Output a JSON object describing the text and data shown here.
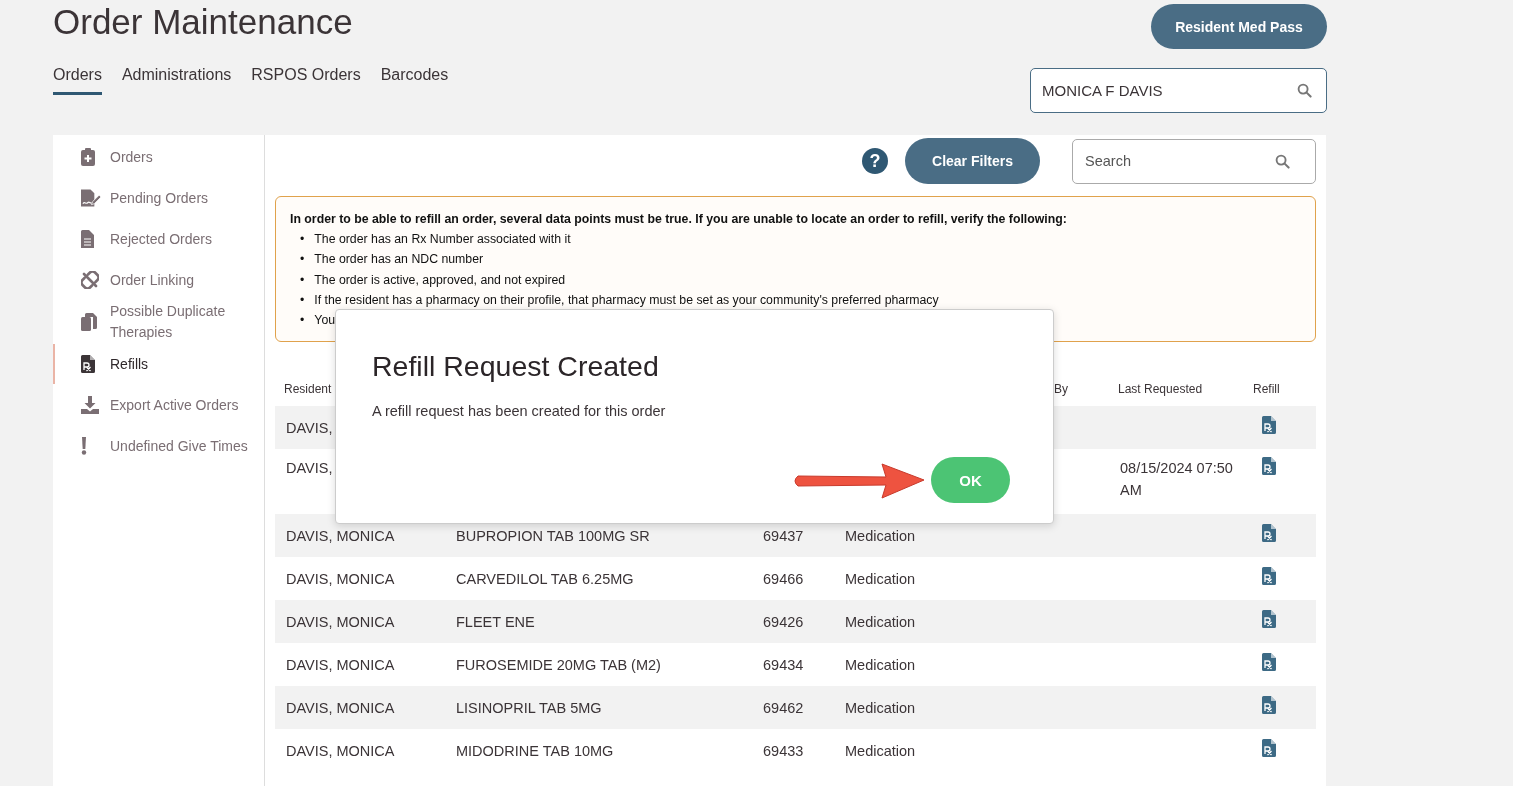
{
  "page": {
    "title": "Order Maintenance",
    "action_button": "Resident Med Pass",
    "resident_search": {
      "value": "MONICA F DAVIS"
    },
    "tabs": [
      {
        "label": "Orders",
        "selected": true
      },
      {
        "label": "Administrations",
        "selected": false
      },
      {
        "label": "RSPOS Orders",
        "selected": false
      },
      {
        "label": "Barcodes",
        "selected": false
      }
    ]
  },
  "sidebar": {
    "items": [
      {
        "label": "Orders",
        "kind": "clipboard",
        "selected": false
      },
      {
        "label": "Pending Orders",
        "kind": "signature",
        "selected": false
      },
      {
        "label": "Rejected Orders",
        "kind": "document",
        "selected": false
      },
      {
        "label": "Order Linking",
        "kind": "unlink",
        "selected": false
      },
      {
        "label": "Possible Duplicate Therapies",
        "kind": "copy",
        "selected": false
      },
      {
        "label": "Refills",
        "kind": "rx",
        "selected": true
      },
      {
        "label": "Export Active Orders",
        "kind": "download",
        "selected": false
      },
      {
        "label": "Undefined Give Times",
        "kind": "exclamation",
        "selected": false
      }
    ]
  },
  "toolbar": {
    "help": "?",
    "clear_button": "Clear Filters",
    "search": {
      "placeholder": "Search"
    }
  },
  "notice": {
    "heading": "In order to be able to refill an order, several data points must be true. If you are unable to locate an order to refill, verify the following:",
    "items": [
      {
        "marker": "•",
        "text": "The order has an Rx Number associated with it"
      },
      {
        "marker": "•",
        "text": "The order has an NDC number"
      },
      {
        "marker": "•",
        "text": "The order is active, approved, and not expired"
      },
      {
        "marker": "•",
        "text": "If the resident has a pharmacy on their profile, that pharmacy must be set as your community's preferred pharmacy"
      },
      {
        "marker": "•",
        "text": "You"
      }
    ]
  },
  "table": {
    "header": {
      "resident": "Resident",
      "by": "By",
      "last_requested": "Last Requested",
      "refill": "Refill"
    },
    "rows": [
      {
        "resident": "DAVIS,"
      },
      {
        "resident": "DAVIS,",
        "last_requested": "08/15/2024 07:50 AM"
      },
      {
        "resident": "DAVIS, MONICA",
        "order": "BUPROPION TAB 100MG SR",
        "number": "69437",
        "type": "Medication"
      },
      {
        "resident": "DAVIS, MONICA",
        "order": "CARVEDILOL TAB 6.25MG",
        "number": "69466",
        "type": "Medication"
      },
      {
        "resident": "DAVIS, MONICA",
        "order": "FLEET ENE",
        "number": "69426",
        "type": "Medication"
      },
      {
        "resident": "DAVIS, MONICA",
        "order": "FUROSEMIDE 20MG TAB (M2)",
        "number": "69434",
        "type": "Medication"
      },
      {
        "resident": "DAVIS, MONICA",
        "order": "LISINOPRIL TAB 5MG",
        "number": "69462",
        "type": "Medication"
      },
      {
        "resident": "DAVIS, MONICA",
        "order": "MIDODRINE TAB 10MG",
        "number": "69433",
        "type": "Medication"
      }
    ]
  },
  "dialog": {
    "title": "Refill Request Created",
    "message": "A refill request has been created for this order",
    "ok_button": "OK"
  }
}
